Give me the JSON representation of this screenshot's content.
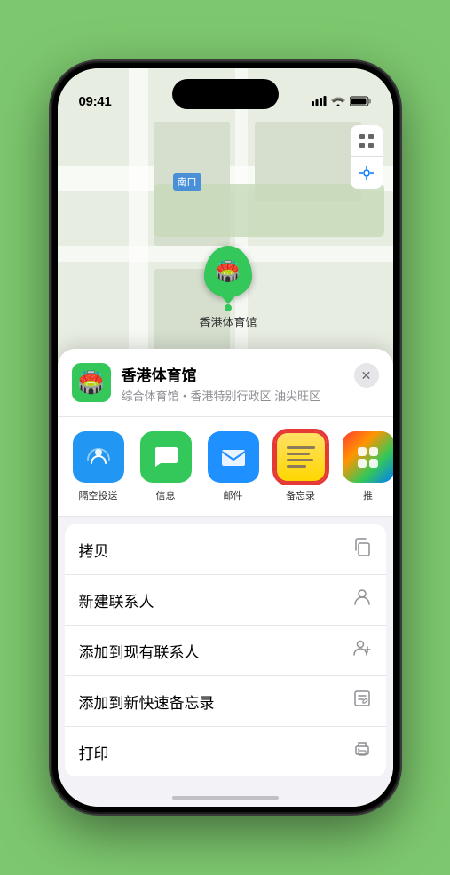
{
  "status_bar": {
    "time": "09:41",
    "signal": "▐▐▐▐",
    "wifi": "WiFi",
    "battery": "🔋"
  },
  "map": {
    "label": "南口",
    "marker_label": "香港体育馆"
  },
  "venue": {
    "name": "香港体育馆",
    "description": "综合体育馆・香港特别行政区 油尖旺区",
    "close_label": "✕"
  },
  "share_items": [
    {
      "id": "airdrop",
      "label": "隔空投送",
      "type": "airdrop"
    },
    {
      "id": "messages",
      "label": "信息",
      "type": "messages"
    },
    {
      "id": "mail",
      "label": "邮件",
      "type": "mail"
    },
    {
      "id": "notes",
      "label": "备忘录",
      "type": "notes"
    },
    {
      "id": "more",
      "label": "推",
      "type": "more-apps"
    }
  ],
  "actions": [
    {
      "id": "copy",
      "label": "拷贝",
      "icon": "copy"
    },
    {
      "id": "new-contact",
      "label": "新建联系人",
      "icon": "person"
    },
    {
      "id": "add-existing",
      "label": "添加到现有联系人",
      "icon": "person-add"
    },
    {
      "id": "quick-note",
      "label": "添加到新快速备忘录",
      "icon": "quick-note"
    },
    {
      "id": "print",
      "label": "打印",
      "icon": "print"
    }
  ]
}
